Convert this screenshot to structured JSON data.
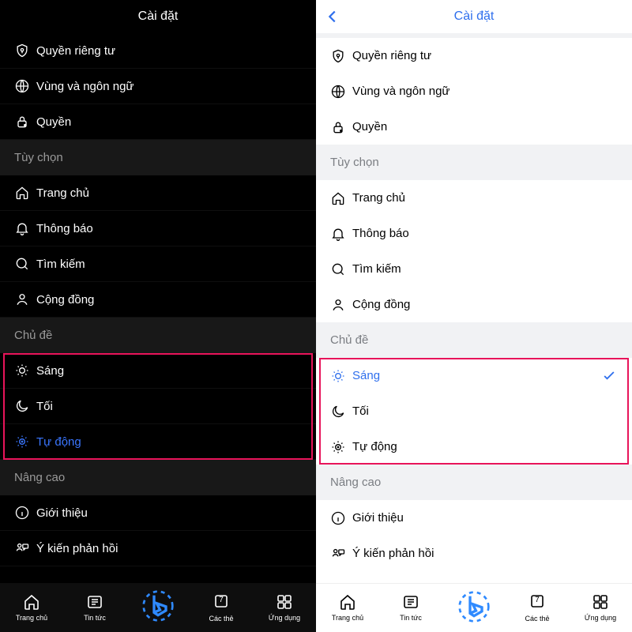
{
  "colors": {
    "accent": "#2f6fed",
    "highlight": "#e8145a"
  },
  "header": {
    "title": "Cài đặt",
    "back": "‹"
  },
  "sections": {
    "general": [
      {
        "icon": "shield-lock",
        "label": "Quyền riêng tư"
      },
      {
        "icon": "globe",
        "label": "Vùng và ngôn ngữ"
      },
      {
        "icon": "lock",
        "label": "Quyền"
      }
    ],
    "pref_header": "Tùy chọn",
    "prefs": [
      {
        "icon": "home",
        "label": "Trang chủ"
      },
      {
        "icon": "bell",
        "label": "Thông báo"
      },
      {
        "icon": "search",
        "label": "Tìm kiếm"
      },
      {
        "icon": "person",
        "label": "Cộng đồng"
      }
    ],
    "theme_header": "Chủ đề",
    "themes": [
      {
        "icon": "sun",
        "label": "Sáng",
        "id": "light"
      },
      {
        "icon": "moon",
        "label": "Tối",
        "id": "dark"
      },
      {
        "icon": "auto",
        "label": "Tự động",
        "id": "auto"
      }
    ],
    "advanced_header": "Nâng cao",
    "advanced": [
      {
        "icon": "info",
        "label": "Giới thiệu"
      },
      {
        "icon": "feedback",
        "label": "Ý kiến phản hồi"
      }
    ]
  },
  "tabbar": {
    "home": "Trang chủ",
    "news": "Tin tức",
    "cards": "Các thẻ",
    "apps": "Ứng dụng",
    "cards_badge": "7"
  },
  "dark_selected": "auto",
  "light_selected": "light"
}
